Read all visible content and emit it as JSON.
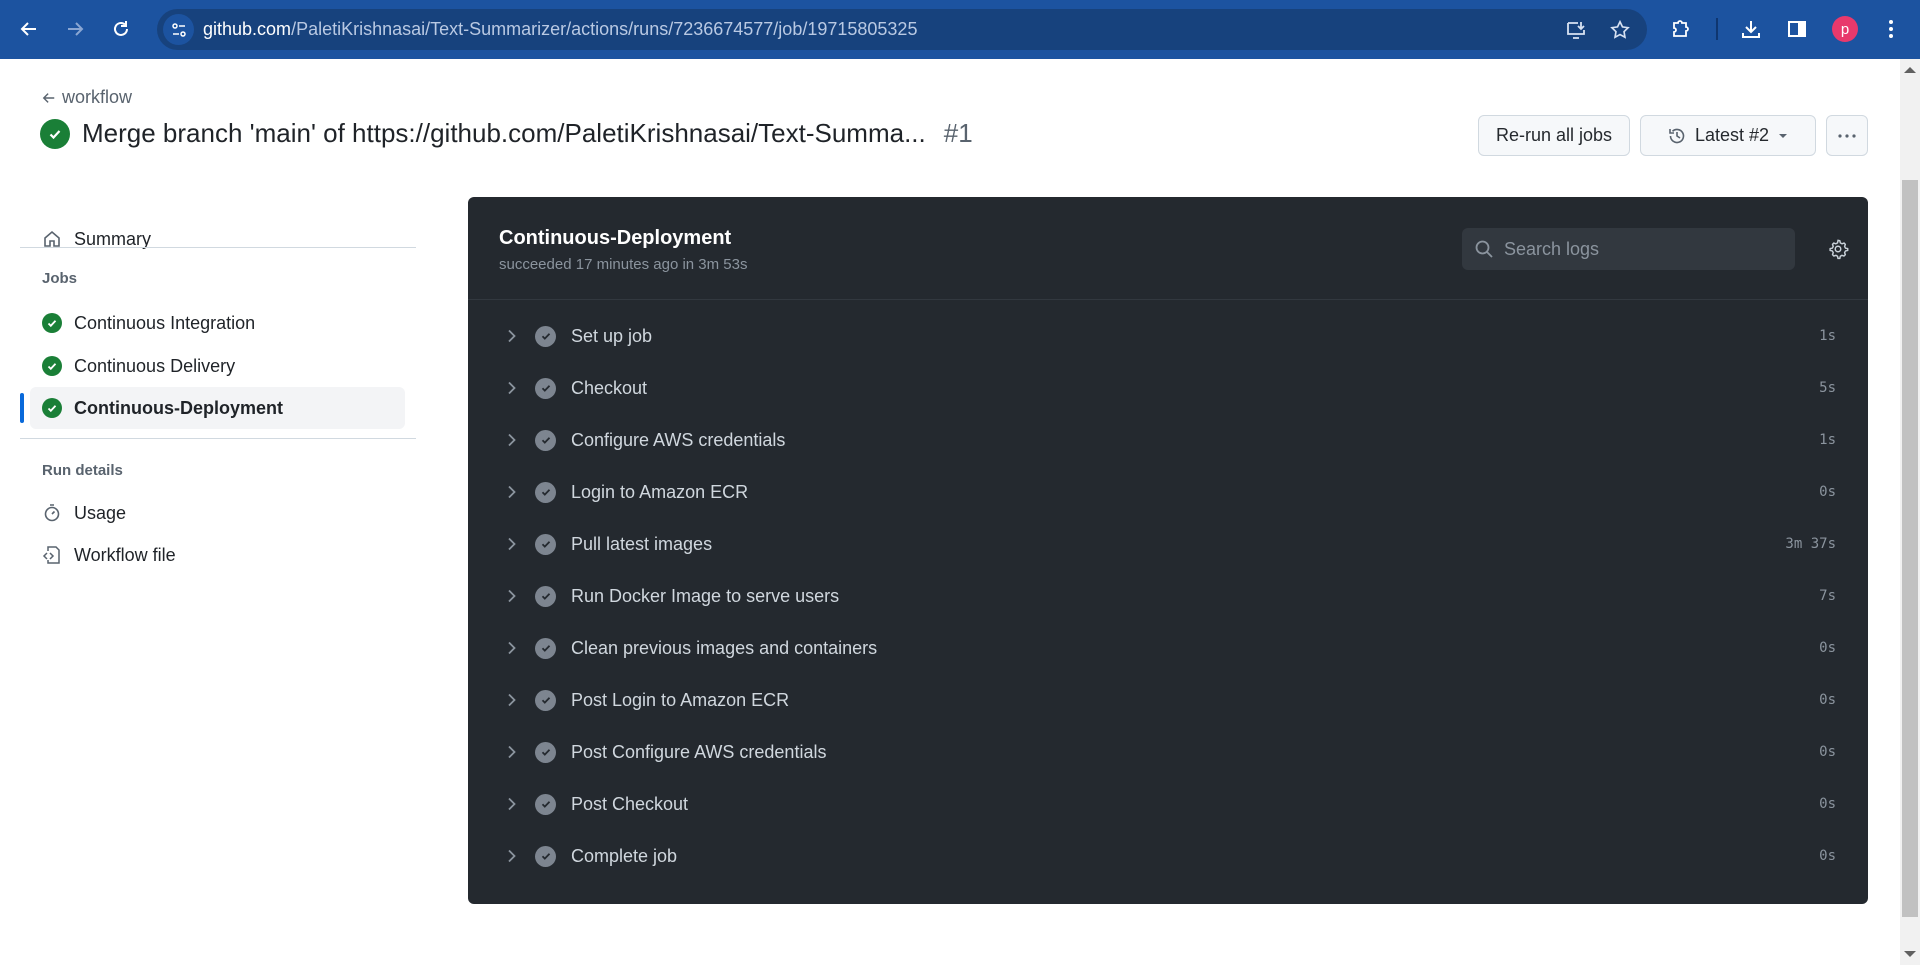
{
  "browser": {
    "url_host": "github.com",
    "url_path": "/PaletiKrishnasai/Text-Summarizer/actions/runs/7236674577/job/19715805325",
    "avatar_letter": "p",
    "colors": {
      "toolbar": "#1c53a0",
      "omnibox": "#17427d",
      "avatar": "#e8396c"
    }
  },
  "header": {
    "back_label": "workflow",
    "title": "Merge branch 'main' of https://github.com/PaletiKrishnasai/Text-Summa...",
    "run_number": "#1",
    "rerun_label": "Re-run all jobs",
    "attempt_label": "Latest #2"
  },
  "sidebar": {
    "summary_label": "Summary",
    "jobs_heading": "Jobs",
    "jobs": [
      {
        "label": "Continuous Integration",
        "status": "success",
        "active": false
      },
      {
        "label": "Continuous Delivery",
        "status": "success",
        "active": false
      },
      {
        "label": "Continuous-Deployment",
        "status": "success",
        "active": true
      }
    ],
    "run_details_heading": "Run details",
    "usage_label": "Usage",
    "workflow_file_label": "Workflow file"
  },
  "job": {
    "name": "Continuous-Deployment",
    "status_text": "succeeded 17 minutes ago in 3m 53s",
    "search_placeholder": "Search logs",
    "steps": [
      {
        "name": "Set up job",
        "duration": "1s"
      },
      {
        "name": "Checkout",
        "duration": "5s"
      },
      {
        "name": "Configure AWS credentials",
        "duration": "1s"
      },
      {
        "name": "Login to Amazon ECR",
        "duration": "0s"
      },
      {
        "name": "Pull latest images",
        "duration": "3m 37s"
      },
      {
        "name": "Run Docker Image to serve users",
        "duration": "7s"
      },
      {
        "name": "Clean previous images and containers",
        "duration": "0s"
      },
      {
        "name": "Post Login to Amazon ECR",
        "duration": "0s"
      },
      {
        "name": "Post Configure AWS credentials",
        "duration": "0s"
      },
      {
        "name": "Post Checkout",
        "duration": "0s"
      },
      {
        "name": "Complete job",
        "duration": "0s"
      }
    ]
  },
  "colors": {
    "success": "#1a7f37",
    "accent": "#0969da",
    "card_bg": "#24292f"
  }
}
